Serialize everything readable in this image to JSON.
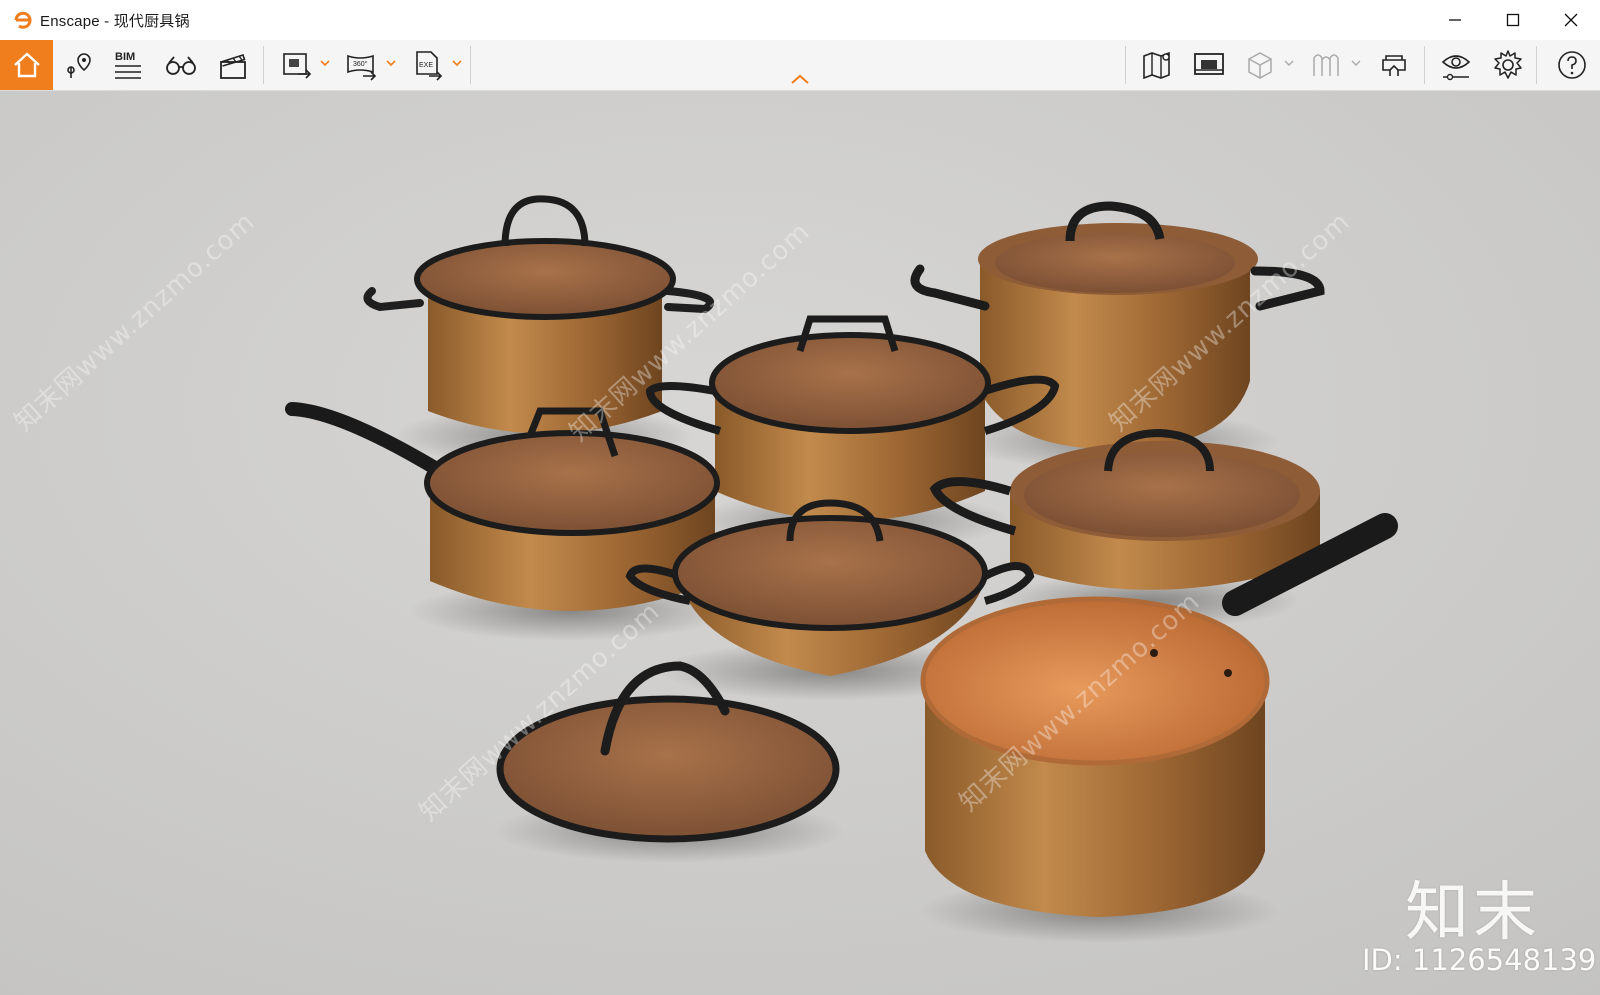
{
  "window": {
    "title": "Enscape - 现代厨具锅",
    "controls": [
      "minimize-icon",
      "maximize-icon",
      "close-icon"
    ]
  },
  "toolbar": {
    "left_tools": [
      {
        "name": "home-icon",
        "active": true
      },
      {
        "name": "location-pin-icon"
      },
      {
        "name": "bim-icon",
        "label": "BIM"
      },
      {
        "name": "binoculars-icon"
      },
      {
        "name": "clapperboard-icon"
      },
      {
        "name": "render-image-icon",
        "dropdown": true
      },
      {
        "name": "panorama-360-icon",
        "label": "360°",
        "dropdown": true
      },
      {
        "name": "export-exe-icon",
        "label": "EXE",
        "dropdown": true
      }
    ],
    "right_tools": [
      {
        "name": "map-icon"
      },
      {
        "name": "screen-icon"
      },
      {
        "name": "cube-icon",
        "dropdown": true
      },
      {
        "name": "asset-library-icon",
        "dropdown": true
      },
      {
        "name": "vr-headset-icon"
      },
      {
        "name": "eye-visual-settings-icon"
      },
      {
        "name": "gear-icon"
      },
      {
        "name": "help-icon"
      }
    ],
    "accent_color": "#f07e1d"
  },
  "viewport": {
    "watermark_brand": "知末",
    "watermark_id": "ID: 1126548139",
    "watermark_repeat": "知末网www.znzmo.com"
  }
}
